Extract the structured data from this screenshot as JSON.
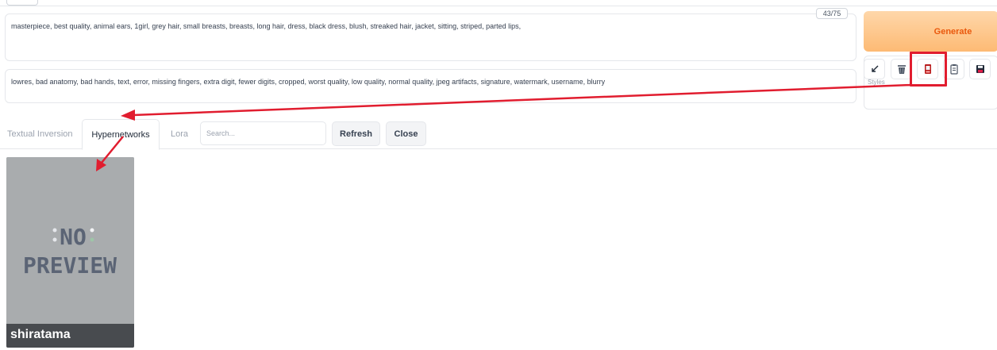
{
  "prompt": {
    "positive": "masterpiece, best quality, animal ears, 1girl, grey hair, small breasts, breasts, long hair, dress, black dress, blush, streaked hair, jacket, sitting, striped, parted lips,",
    "negative": "lowres, bad anatomy, bad hands, text, error, missing fingers, extra digit, fewer digits, cropped, worst quality, low quality, normal quality, jpeg artifacts, signature, watermark, username, blurry",
    "token_counter": "43/75"
  },
  "actions": {
    "generate_label": "Generate",
    "styles_label": "Styles",
    "tool_icons": [
      "arrow-icon",
      "trash-icon",
      "show-extra-networks-icon",
      "clipboard-icon",
      "save-icon"
    ]
  },
  "extra_networks": {
    "tabs": [
      {
        "label": "Textual Inversion",
        "active": false
      },
      {
        "label": "Hypernetworks",
        "active": true
      },
      {
        "label": "Lora",
        "active": false
      }
    ],
    "search_placeholder": "Search...",
    "refresh_label": "Refresh",
    "close_label": "Close",
    "cards": [
      {
        "name": "shiratama",
        "preview_text": [
          "NO",
          "PREVIEW"
        ]
      }
    ]
  },
  "colors": {
    "annotation": "#e11d2f",
    "generate_text": "#ea580c",
    "generate_bg": "#fdba74"
  }
}
